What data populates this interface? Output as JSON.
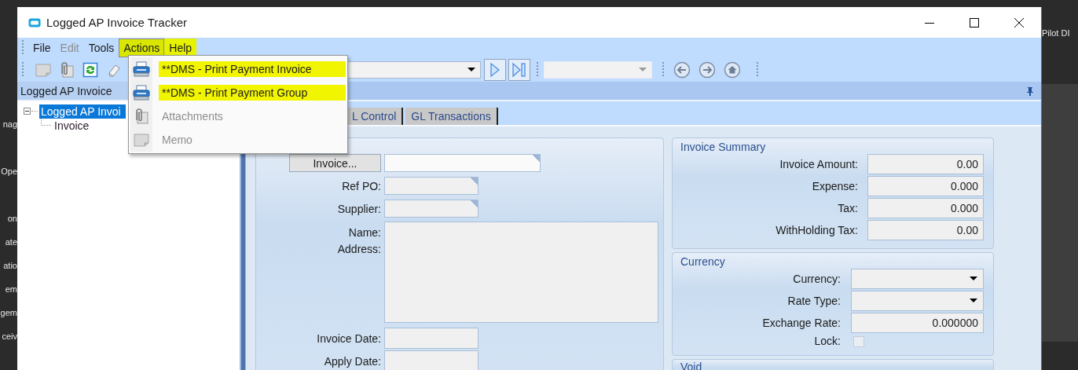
{
  "desktop": {
    "left_labels": [
      "nag",
      "Ope",
      "on",
      "ate",
      "atio",
      "em",
      "gem",
      "ceiv"
    ],
    "right_label": "Pilot DI"
  },
  "window": {
    "title": "Logged AP Invoice Tracker"
  },
  "menu_bar": {
    "items": [
      {
        "label": "File",
        "disabled": false,
        "selected": false,
        "highlighted": false
      },
      {
        "label": "Edit",
        "disabled": true,
        "selected": false,
        "highlighted": false
      },
      {
        "label": "Tools",
        "disabled": false,
        "selected": false,
        "highlighted": false
      },
      {
        "label": "Actions",
        "disabled": false,
        "selected": true,
        "highlighted": true
      },
      {
        "label": "Help",
        "disabled": false,
        "selected": false,
        "highlighted": true
      }
    ]
  },
  "toolbar": {
    "record_combo": {
      "disabled": false
    },
    "view_combo": {
      "disabled": true
    }
  },
  "actions_menu": {
    "items": [
      {
        "kind": "print",
        "label": "**DMS - Print Payment Invoice",
        "disabled": false,
        "highlighted": true
      },
      {
        "kind": "print",
        "label": "**DMS - Print Payment Group",
        "disabled": false,
        "highlighted": true
      },
      {
        "kind": "attach",
        "label": "Attachments",
        "disabled": true,
        "highlighted": false
      },
      {
        "kind": "memo",
        "label": "Memo",
        "disabled": true,
        "highlighted": false
      }
    ]
  },
  "tree_panel": {
    "title": "Logged AP Invoice",
    "nodes": [
      {
        "label": "Logged AP Invoi",
        "selected": true,
        "expanded": true,
        "children": [
          {
            "label": "Invoice",
            "selected": false
          }
        ]
      }
    ]
  },
  "tabs": [
    {
      "label": "L Control",
      "selected": false
    },
    {
      "label": "GL Transactions",
      "selected": false
    }
  ],
  "invoice_form": {
    "invoice_button": "Invoice...",
    "lookup_fields": [
      {
        "label": "Ref PO:"
      },
      {
        "label": "Supplier:"
      }
    ],
    "name_label": "Name:",
    "address_label": "Address:",
    "date_fields": [
      {
        "label": "Invoice Date:"
      },
      {
        "label": "Apply Date:"
      }
    ]
  },
  "invoice_summary": {
    "title": "Invoice Summary",
    "rows": [
      {
        "label": "Invoice Amount:",
        "value": "0.00"
      },
      {
        "label": "Expense:",
        "value": "0.000"
      },
      {
        "label": "Tax:",
        "value": "0.000"
      },
      {
        "label": "WithHolding Tax:",
        "value": "0.00"
      }
    ]
  },
  "currency": {
    "title": "Currency",
    "rows": [
      {
        "kind": "dropdown",
        "label": "Currency:"
      },
      {
        "kind": "dropdown",
        "label": "Rate Type:"
      },
      {
        "kind": "number",
        "label": "Exchange Rate:",
        "value": "0.000000"
      },
      {
        "kind": "checkbox",
        "label": "Lock:",
        "checked": false,
        "disabled": true
      }
    ]
  },
  "void": {
    "title": "Void"
  }
}
